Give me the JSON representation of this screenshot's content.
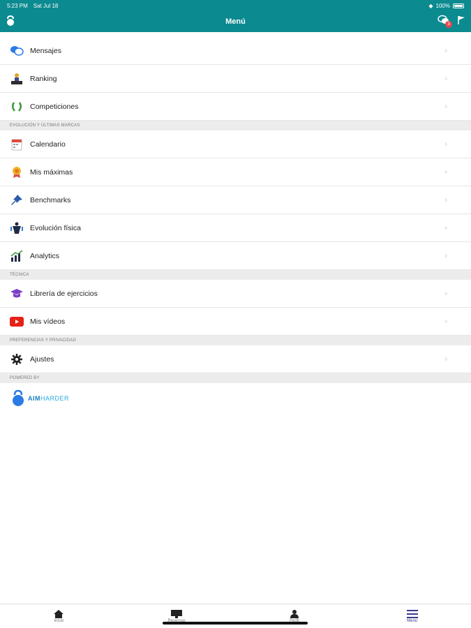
{
  "status": {
    "time": "5:23 PM",
    "date": "Sat Jul 18",
    "battery": "100%"
  },
  "nav": {
    "title": "Menú",
    "badge_count": "3"
  },
  "items_top": [
    {
      "label": "Mensajes",
      "icon": "chat-icon"
    },
    {
      "label": "Ranking",
      "icon": "podium-icon"
    },
    {
      "label": "Competiciones",
      "icon": "laurel-icon"
    }
  ],
  "section1": "EVOLUCIÓN Y ÚLTIMAS MARCAS",
  "items_evo": [
    {
      "label": "Calendario",
      "icon": "calendar-icon"
    },
    {
      "label": "Mis máximas",
      "icon": "medal-icon"
    },
    {
      "label": "Benchmarks",
      "icon": "pin-icon"
    },
    {
      "label": "Evolución física",
      "icon": "body-icon"
    },
    {
      "label": "Analytics",
      "icon": "chart-icon"
    }
  ],
  "section2": "TÉCNICA",
  "items_tec": [
    {
      "label": "Librería de ejercicios",
      "icon": "graduation-cap-icon"
    },
    {
      "label": "Mis vídeos",
      "icon": "youtube-icon"
    }
  ],
  "section3": "PREFERENCIAS Y PRIVACIDAD",
  "items_pref": [
    {
      "label": "Ajustes",
      "icon": "gear-icon"
    }
  ],
  "section4": "POWERED BY",
  "brand": {
    "part1": "AIM",
    "part2": "HARDER"
  },
  "tabs": [
    {
      "label": "Inicio",
      "icon": "home-icon"
    },
    {
      "label": "Reservas",
      "icon": "board-icon"
    },
    {
      "label": "Perfil",
      "icon": "person-icon"
    },
    {
      "label": "Menú",
      "icon": "hamburger-icon"
    }
  ],
  "colors": {
    "header": "#0b8a8f",
    "section_bg": "#ececec",
    "badge": "#e5484d",
    "active_tab": "#3a3a8c"
  }
}
